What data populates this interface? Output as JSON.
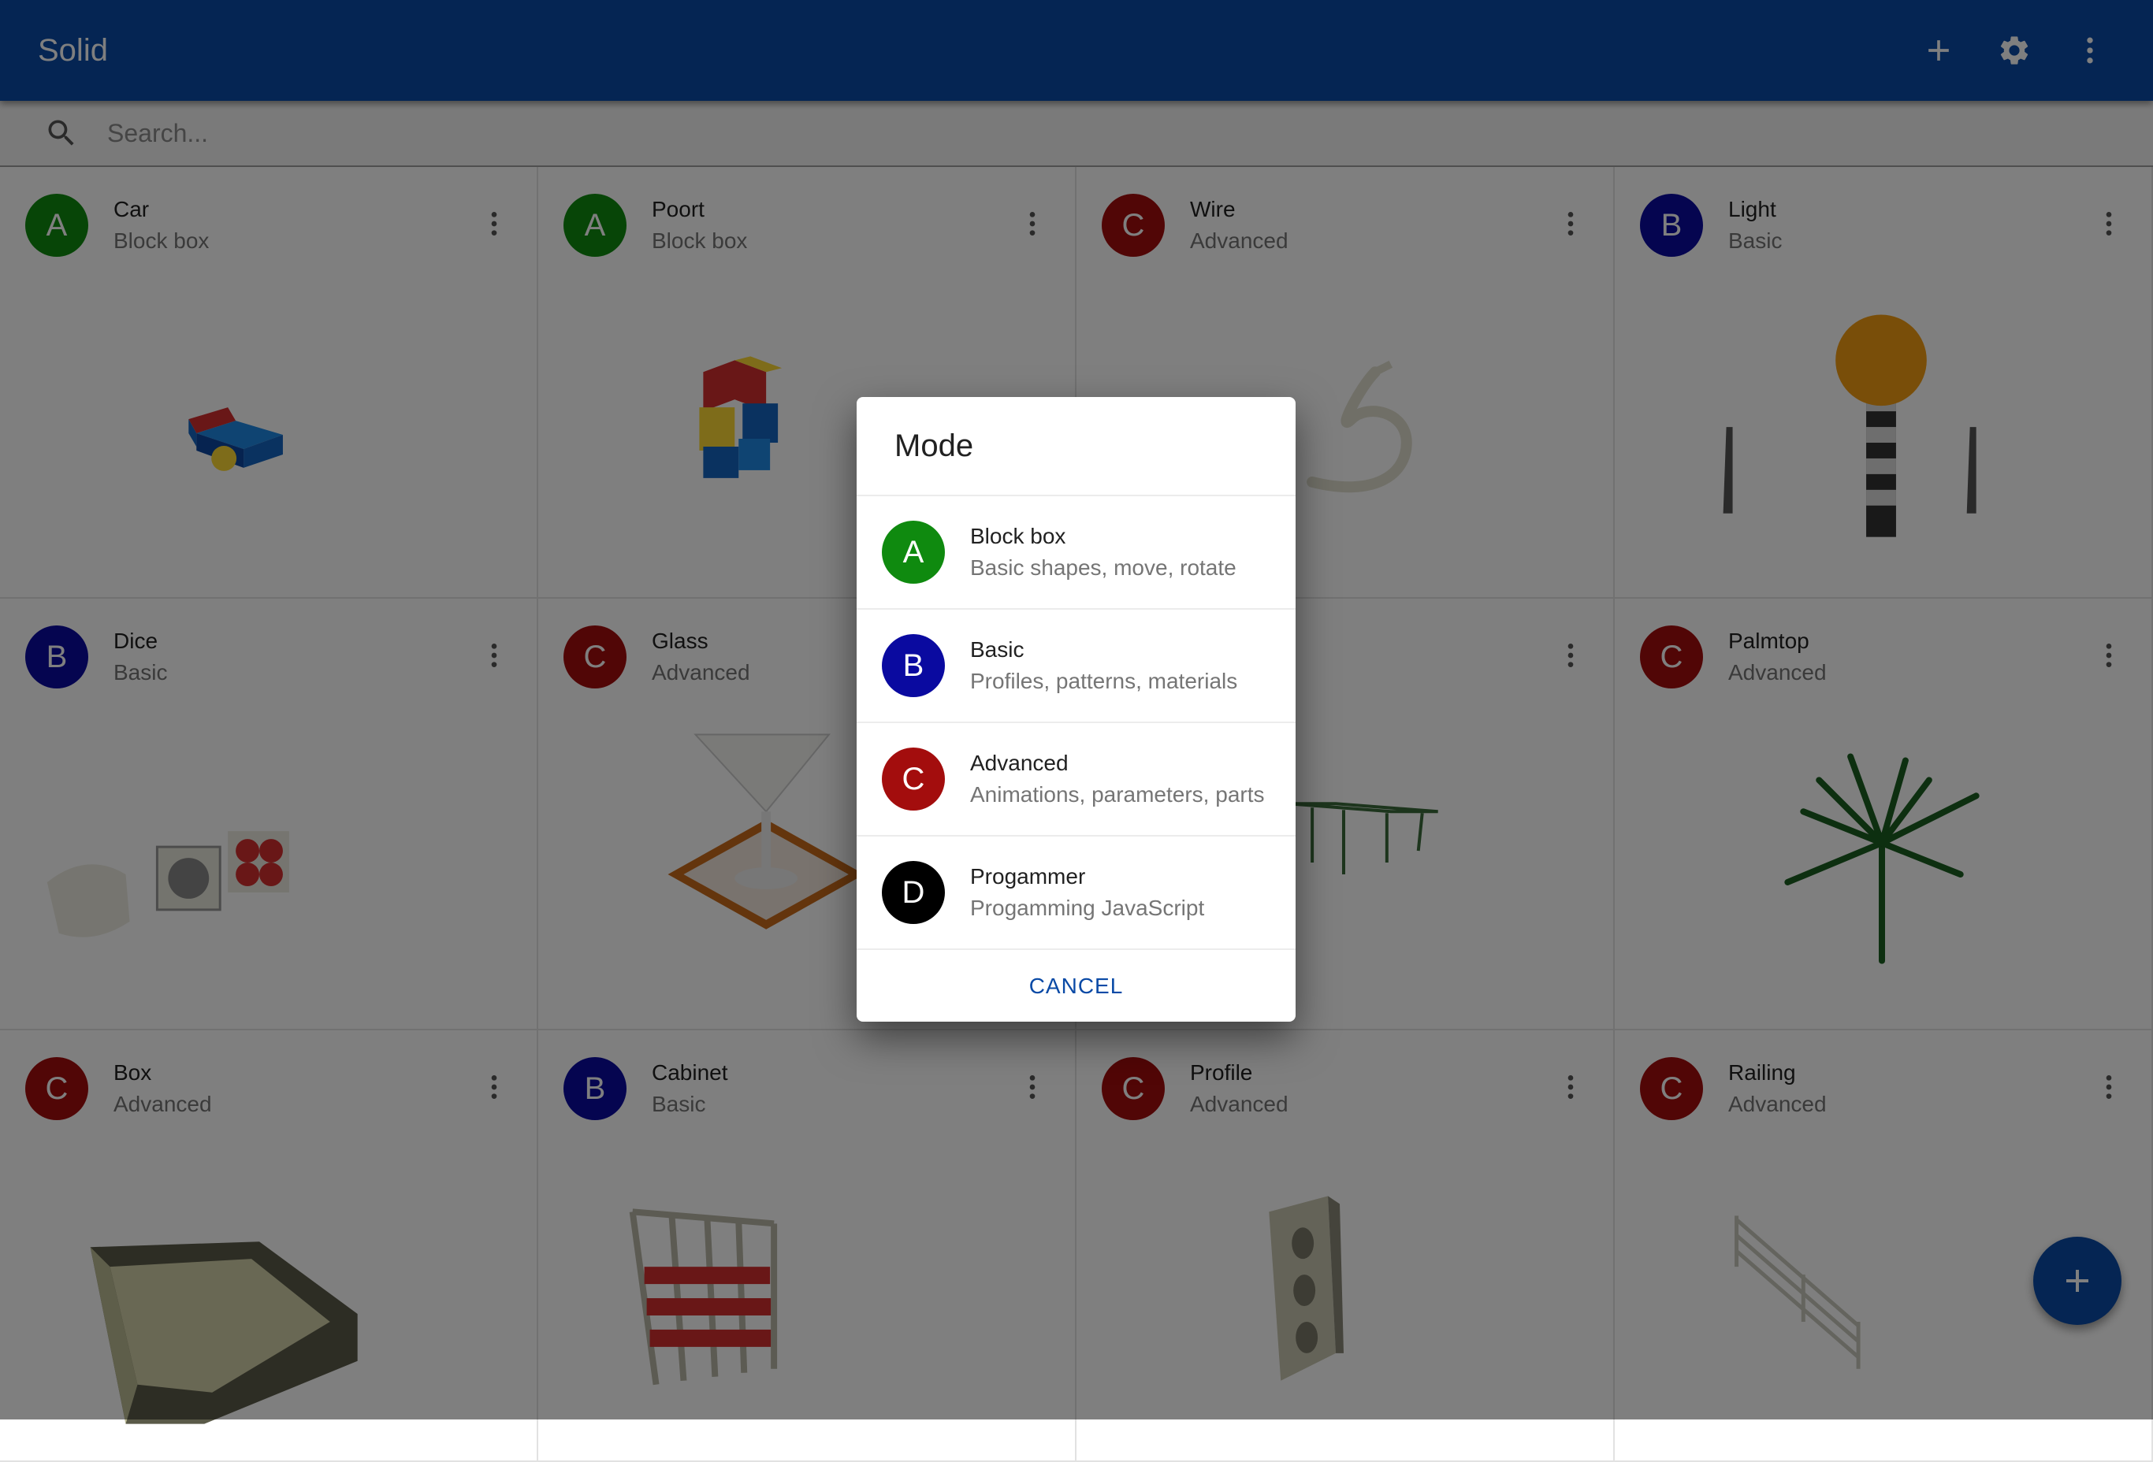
{
  "app": {
    "title": "Solid"
  },
  "search": {
    "placeholder": "Search..."
  },
  "colors": {
    "primary": "#0a4aa6",
    "levelA": "#0f8a0f",
    "levelB": "#0a0aa0",
    "levelC": "#a30d0d",
    "levelD": "#000000"
  },
  "icons": [
    "add-icon",
    "settings-icon",
    "more-vert-icon",
    "search-icon"
  ],
  "cards": [
    {
      "letter": "A",
      "title": "Car",
      "subtitle": "Block box"
    },
    {
      "letter": "A",
      "title": "Poort",
      "subtitle": "Block box"
    },
    {
      "letter": "C",
      "title": "Wire",
      "subtitle": "Advanced"
    },
    {
      "letter": "B",
      "title": "Light",
      "subtitle": "Basic"
    },
    {
      "letter": "B",
      "title": "Dice",
      "subtitle": "Basic"
    },
    {
      "letter": "C",
      "title": "Glass",
      "subtitle": "Advanced"
    },
    {
      "letter": "",
      "title": "",
      "subtitle": ""
    },
    {
      "letter": "C",
      "title": "Palmtop",
      "subtitle": "Advanced"
    },
    {
      "letter": "C",
      "title": "Box",
      "subtitle": "Advanced"
    },
    {
      "letter": "B",
      "title": "Cabinet",
      "subtitle": "Basic"
    },
    {
      "letter": "C",
      "title": "Profile",
      "subtitle": "Advanced"
    },
    {
      "letter": "C",
      "title": "Railing",
      "subtitle": "Advanced"
    }
  ],
  "dialog": {
    "title": "Mode",
    "items": [
      {
        "letter": "A",
        "label": "Block box",
        "description": "Basic shapes, move, rotate"
      },
      {
        "letter": "B",
        "label": "Basic",
        "description": "Profiles, patterns, materials"
      },
      {
        "letter": "C",
        "label": "Advanced",
        "description": "Animations, parameters, parts"
      },
      {
        "letter": "D",
        "label": "Progammer",
        "description": "Progamming JavaScript"
      }
    ],
    "cancel_label": "CANCEL"
  }
}
